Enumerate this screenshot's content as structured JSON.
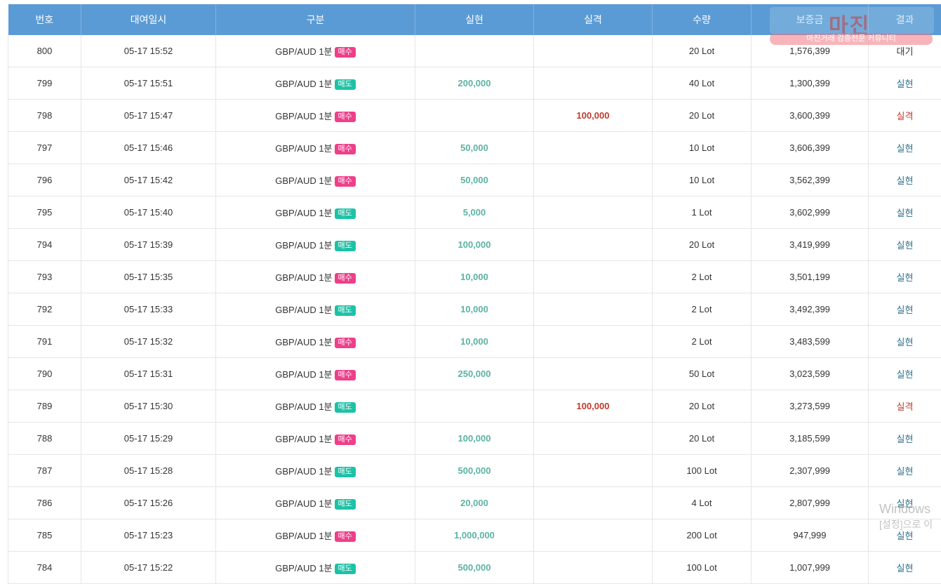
{
  "columns": [
    "번호",
    "대여일시",
    "구분",
    "실현",
    "실격",
    "수량",
    "보증금",
    "결과"
  ],
  "rows": [
    {
      "no": "800",
      "date": "05-17 15:52",
      "pair": "GBP/AUD 1분",
      "side": "매수",
      "side_type": "buy",
      "profit": "",
      "loss": "",
      "qty": "20 Lot",
      "deposit": "1,576,399",
      "result": "대기",
      "result_type": "waiting"
    },
    {
      "no": "799",
      "date": "05-17 15:51",
      "pair": "GBP/AUD 1분",
      "side": "매도",
      "side_type": "sell",
      "profit": "200,000",
      "loss": "",
      "qty": "40 Lot",
      "deposit": "1,300,399",
      "result": "실현",
      "result_type": "realized"
    },
    {
      "no": "798",
      "date": "05-17 15:47",
      "pair": "GBP/AUD 1분",
      "side": "매수",
      "side_type": "buy",
      "profit": "",
      "loss": "100,000",
      "qty": "20 Lot",
      "deposit": "3,600,399",
      "result": "실격",
      "result_type": "lost"
    },
    {
      "no": "797",
      "date": "05-17 15:46",
      "pair": "GBP/AUD 1분",
      "side": "매수",
      "side_type": "buy",
      "profit": "50,000",
      "loss": "",
      "qty": "10 Lot",
      "deposit": "3,606,399",
      "result": "실현",
      "result_type": "realized"
    },
    {
      "no": "796",
      "date": "05-17 15:42",
      "pair": "GBP/AUD 1분",
      "side": "매수",
      "side_type": "buy",
      "profit": "50,000",
      "loss": "",
      "qty": "10 Lot",
      "deposit": "3,562,399",
      "result": "실현",
      "result_type": "realized"
    },
    {
      "no": "795",
      "date": "05-17 15:40",
      "pair": "GBP/AUD 1분",
      "side": "매도",
      "side_type": "sell",
      "profit": "5,000",
      "loss": "",
      "qty": "1 Lot",
      "deposit": "3,602,999",
      "result": "실현",
      "result_type": "realized"
    },
    {
      "no": "794",
      "date": "05-17 15:39",
      "pair": "GBP/AUD 1분",
      "side": "매도",
      "side_type": "sell",
      "profit": "100,000",
      "loss": "",
      "qty": "20 Lot",
      "deposit": "3,419,999",
      "result": "실현",
      "result_type": "realized"
    },
    {
      "no": "793",
      "date": "05-17 15:35",
      "pair": "GBP/AUD 1분",
      "side": "매수",
      "side_type": "buy",
      "profit": "10,000",
      "loss": "",
      "qty": "2 Lot",
      "deposit": "3,501,199",
      "result": "실현",
      "result_type": "realized"
    },
    {
      "no": "792",
      "date": "05-17 15:33",
      "pair": "GBP/AUD 1분",
      "side": "매도",
      "side_type": "sell",
      "profit": "10,000",
      "loss": "",
      "qty": "2 Lot",
      "deposit": "3,492,399",
      "result": "실현",
      "result_type": "realized"
    },
    {
      "no": "791",
      "date": "05-17 15:32",
      "pair": "GBP/AUD 1분",
      "side": "매수",
      "side_type": "buy",
      "profit": "10,000",
      "loss": "",
      "qty": "2 Lot",
      "deposit": "3,483,599",
      "result": "실현",
      "result_type": "realized"
    },
    {
      "no": "790",
      "date": "05-17 15:31",
      "pair": "GBP/AUD 1분",
      "side": "매수",
      "side_type": "buy",
      "profit": "250,000",
      "loss": "",
      "qty": "50 Lot",
      "deposit": "3,023,599",
      "result": "실현",
      "result_type": "realized"
    },
    {
      "no": "789",
      "date": "05-17 15:30",
      "pair": "GBP/AUD 1분",
      "side": "매도",
      "side_type": "sell",
      "profit": "",
      "loss": "100,000",
      "qty": "20 Lot",
      "deposit": "3,273,599",
      "result": "실격",
      "result_type": "lost"
    },
    {
      "no": "788",
      "date": "05-17 15:29",
      "pair": "GBP/AUD 1분",
      "side": "매수",
      "side_type": "buy",
      "profit": "100,000",
      "loss": "",
      "qty": "20 Lot",
      "deposit": "3,185,599",
      "result": "실현",
      "result_type": "realized"
    },
    {
      "no": "787",
      "date": "05-17 15:28",
      "pair": "GBP/AUD 1분",
      "side": "매도",
      "side_type": "sell",
      "profit": "500,000",
      "loss": "",
      "qty": "100 Lot",
      "deposit": "2,307,999",
      "result": "실현",
      "result_type": "realized"
    },
    {
      "no": "786",
      "date": "05-17 15:26",
      "pair": "GBP/AUD 1분",
      "side": "매도",
      "side_type": "sell",
      "profit": "20,000",
      "loss": "",
      "qty": "4 Lot",
      "deposit": "2,807,999",
      "result": "실현",
      "result_type": "realized"
    },
    {
      "no": "785",
      "date": "05-17 15:23",
      "pair": "GBP/AUD 1분",
      "side": "매수",
      "side_type": "buy",
      "profit": "1,000,000",
      "loss": "",
      "qty": "200 Lot",
      "deposit": "947,999",
      "result": "실현",
      "result_type": "realized"
    },
    {
      "no": "784",
      "date": "05-17 15:22",
      "pair": "GBP/AUD 1분",
      "side": "매도",
      "side_type": "sell",
      "profit": "500,000",
      "loss": "",
      "qty": "100 Lot",
      "deposit": "1,007,999",
      "result": "실현",
      "result_type": "realized"
    }
  ],
  "watermark": {
    "logo": "마진",
    "slogan": "마진거래 검증전문 커뮤니티"
  },
  "os_notice": {
    "line1": "Windows",
    "line2": "[설정]으로 이"
  },
  "colors": {
    "header_bg": "#5b9bd5",
    "buy_badge": "#ef3e8a",
    "sell_badge": "#1dc2a6",
    "profit": "#5ab3a3",
    "loss": "#c0392b",
    "realized": "#2e6e8c"
  }
}
